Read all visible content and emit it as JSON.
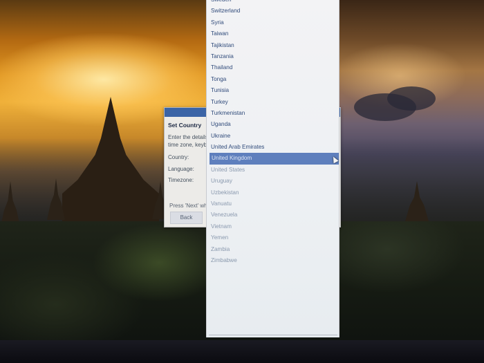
{
  "dialog": {
    "title": "Set Country",
    "description_line1": "Enter the details",
    "description_line2": "time zone, keyb",
    "fields": [
      {
        "label": "Country:"
      },
      {
        "label": "Language:"
      },
      {
        "label": "Timezone:"
      }
    ],
    "hint": "Press 'Next' whe",
    "back_label": "Back"
  },
  "dropdown": {
    "selected": "United Kingdom",
    "items": [
      "Sweden",
      "Switzerland",
      "Syria",
      "Taiwan",
      "Tajikistan",
      "Tanzania",
      "Thailand",
      "Tonga",
      "Tunisia",
      "Turkey",
      "Turkmenistan",
      "Uganda",
      "Ukraine",
      "United Arab Emirates",
      "United Kingdom",
      "United States",
      "Uruguay",
      "Uzbekistan",
      "Vanuatu",
      "Venezuela",
      "Vietnam",
      "Yemen",
      "Zambia",
      "Zimbabwe"
    ]
  },
  "colors": {
    "selection": "#5e7fbd",
    "titlebar": "#3b64a6"
  }
}
